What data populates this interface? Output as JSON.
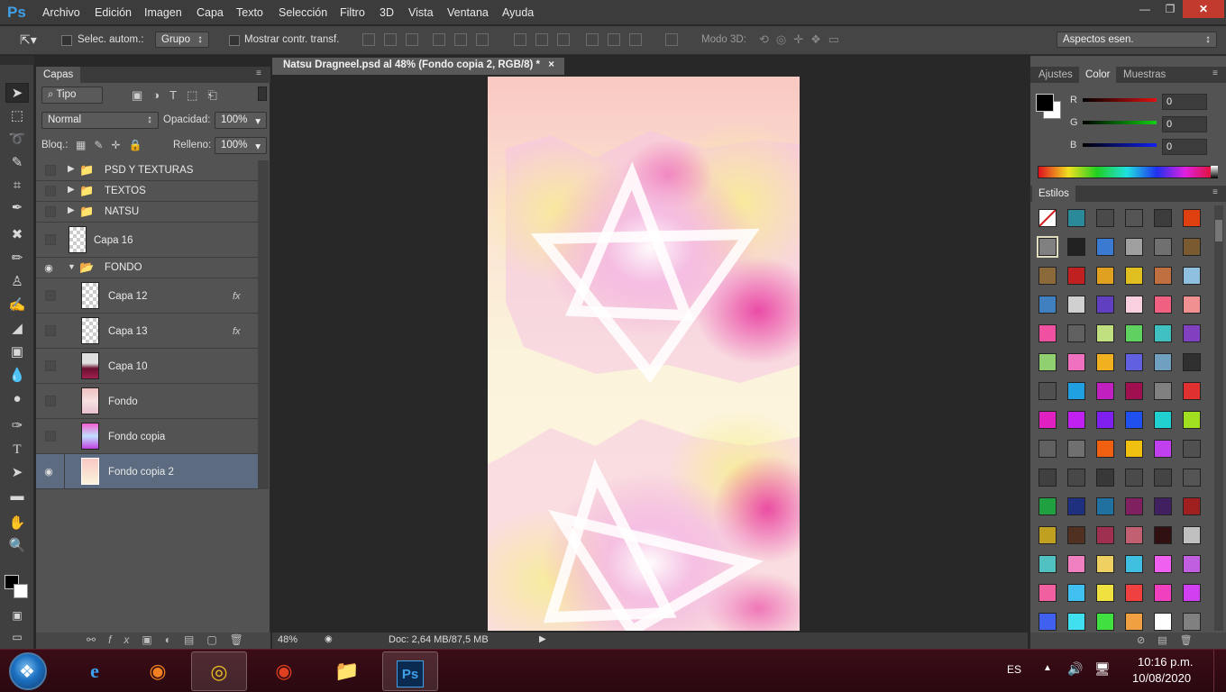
{
  "app": {
    "logo": "Ps"
  },
  "menu": [
    "Archivo",
    "Edición",
    "Imagen",
    "Capa",
    "Texto",
    "Selección",
    "Filtro",
    "3D",
    "Vista",
    "Ventana",
    "Ayuda"
  ],
  "options": {
    "auto_select_label": "Selec. autom.:",
    "auto_select_value": "Grupo",
    "show_transform_label": "Mostrar contr. transf.",
    "mode3d_label": "Modo 3D:",
    "workspace": "Aspectos esen."
  },
  "layers_panel": {
    "tab": "Capas",
    "filter": "Tipo",
    "blend_mode": "Normal",
    "opacity_label": "Opacidad:",
    "opacity_value": "100%",
    "lock_label": "Bloq.:",
    "fill_label": "Relleno:",
    "fill_value": "100%",
    "layers": [
      {
        "name": "PSD Y TEXTURAS",
        "type": "group",
        "visible": false
      },
      {
        "name": "TEXTOS",
        "type": "group",
        "visible": false
      },
      {
        "name": "NATSU",
        "type": "group",
        "visible": false
      },
      {
        "name": "Capa 16",
        "type": "layer",
        "visible": false
      },
      {
        "name": "FONDO",
        "type": "group-open",
        "visible": true
      },
      {
        "name": "Capa 12",
        "type": "child",
        "visible": false,
        "fx": "fx"
      },
      {
        "name": "Capa 13",
        "type": "child",
        "visible": false,
        "fx": "fx"
      },
      {
        "name": "Capa 10",
        "type": "child",
        "visible": false
      },
      {
        "name": "Fondo",
        "type": "child",
        "visible": false
      },
      {
        "name": "Fondo copia",
        "type": "child",
        "visible": false
      },
      {
        "name": "Fondo copia 2",
        "type": "child",
        "visible": true,
        "selected": true
      }
    ]
  },
  "document": {
    "tab_title": "Natsu Dragneel.psd al 48% (Fondo copia 2, RGB/8) *",
    "close": "×",
    "zoom": "48%",
    "doc_info": "Doc: 2,64 MB/87,5 MB"
  },
  "right_panels": {
    "tabs": [
      "Ajustes",
      "Color",
      "Muestras"
    ],
    "active_tab": "Color",
    "color": {
      "channels": [
        {
          "label": "R",
          "value": "0",
          "color": "#d01a1a"
        },
        {
          "label": "G",
          "value": "0",
          "color": "#22b022"
        },
        {
          "label": "B",
          "value": "0",
          "color": "#1a30d0"
        }
      ]
    },
    "styles_tab": "Estilos",
    "swatches": [
      "#ffffff",
      "#2a8a9a",
      "#4a4a4a",
      "#555555",
      "#3c3c3c",
      "#e04010",
      "#808080",
      "#222222",
      "#3a7ad0",
      "#a0a0a0",
      "#707070",
      "#7a5a30",
      "#8a6a3a",
      "#c02020",
      "#e0a020",
      "#e0c020",
      "#c07040",
      "#90c0e0",
      "#4080c0",
      "#d0d0d0",
      "#6040c0",
      "#f8d0e0",
      "#f06080",
      "#f09090",
      "#f050a0",
      "#606060",
      "#c0e080",
      "#60d060",
      "#40c0c0",
      "#8040c0",
      "#90d070",
      "#f070c0",
      "#f0b020",
      "#6060e0",
      "#70a0c0",
      "#303030",
      "#505050",
      "#20a0e0",
      "#c020c0",
      "#a01050",
      "#808080",
      "#e03030",
      "#e020c0",
      "#c020f0",
      "#8020f0",
      "#2050f0",
      "#20d0d0",
      "#a0e020",
      "#606060",
      "#707070",
      "#f06010",
      "#f0c010",
      "#c040f0",
      "#505050",
      "#404040",
      "#484848",
      "#383838",
      "#4a4a4a",
      "#444444",
      "#555555",
      "#20a040",
      "#203080",
      "#2070a0",
      "#802060",
      "#402060",
      "#a02020",
      "#c0a020",
      "#503020",
      "#a03050",
      "#c06070",
      "#301010",
      "#c0c0c0",
      "#50c0c0",
      "#f080c0",
      "#f0d060",
      "#40c0e0",
      "#f060f0",
      "#c060e0",
      "#f060a0",
      "#40c0f0",
      "#f0e040",
      "#f04040",
      "#f040c0",
      "#d040f0",
      "#4060f0",
      "#40e0f0",
      "#40e040",
      "#f0a040",
      "#ffffff",
      "#808080"
    ]
  },
  "taskbar": {
    "language": "ES",
    "time": "10:16 p.m.",
    "date": "10/08/2020",
    "ps_label": "Ps"
  }
}
